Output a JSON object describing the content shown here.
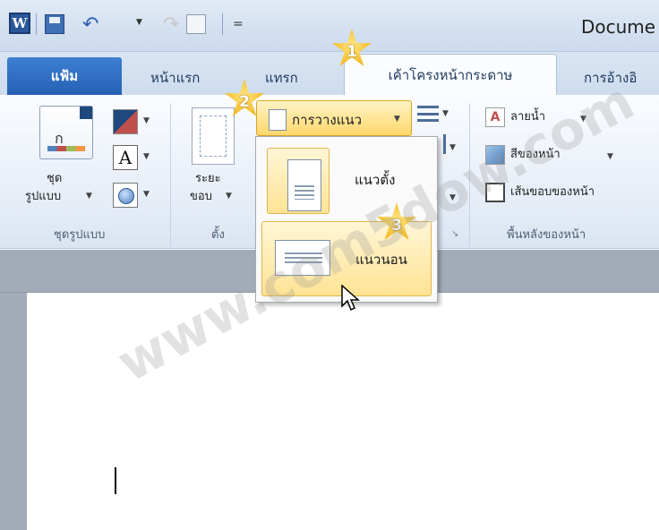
{
  "qat": {
    "word_icon": "W",
    "save_icon": "save-icon",
    "undo_icon": "undo-icon",
    "redo_icon": "redo-icon",
    "customize": "="
  },
  "window": {
    "title": "Docume"
  },
  "tabs": {
    "file": "แฟ้ม",
    "home": "หน้าแรก",
    "insert": "แทรก",
    "page_layout": "เค้าโครงหน้ากระดาษ",
    "references": "การอ้างอิ"
  },
  "ribbon": {
    "themes": {
      "button_label_line1": "ชุด",
      "button_label_line2": "รูปแบบ",
      "group_label": "ชุดรูปแบบ",
      "colors_icon": "colors-icon",
      "fonts_icon_text": "A",
      "effects_icon": "effects-icon"
    },
    "page_setup": {
      "margins_line1": "ระยะ",
      "margins_line2": "ขอบ",
      "orientation_label": "การวางแนว",
      "group_label": "ตั้ง"
    },
    "page_background": {
      "watermark": "ลายน้ำ",
      "page_color": "สีของหน้า",
      "page_borders": "เส้นขอบของหน้า",
      "group_label": "พื้นหลังของหน้า"
    }
  },
  "orientation_menu": {
    "portrait": "แนวตั้ง",
    "landscape": "แนวนอน",
    "selected": "landscape"
  },
  "callouts": [
    "1",
    "2",
    "3"
  ],
  "watermark_text": "www.com5dow.com",
  "colors": {
    "file_tab": "#2b63b8",
    "highlight": "#ffd86b",
    "callout_star": "#f2b51c"
  }
}
